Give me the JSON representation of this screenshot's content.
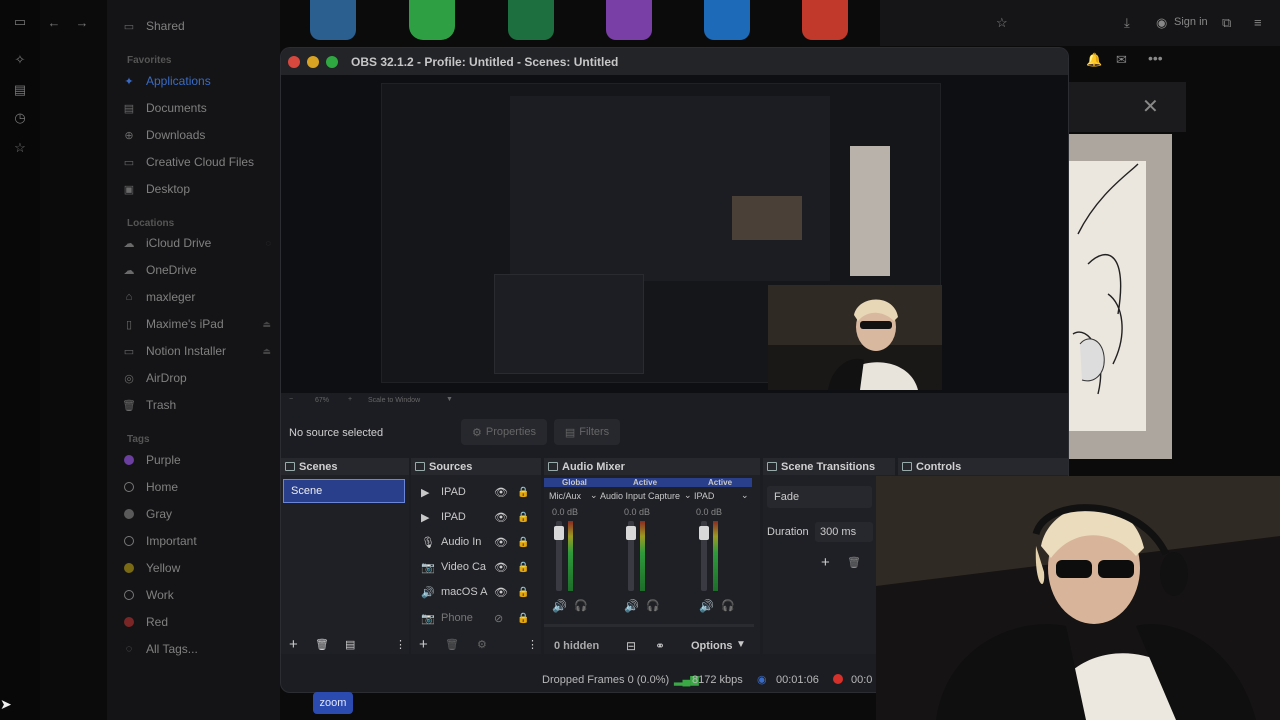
{
  "finder": {
    "shared_label": "Shared",
    "favorites_header": "Favorites",
    "favorites": [
      "Applications",
      "Documents",
      "Downloads",
      "Creative Cloud Files",
      "Desktop"
    ],
    "locations_header": "Locations",
    "locations": [
      "iCloud Drive",
      "OneDrive",
      "maxleger",
      "Maxime's iPad",
      "Notion Installer",
      "AirDrop",
      "Trash"
    ],
    "tags_header": "Tags",
    "tags": [
      {
        "label": "Purple",
        "color": "#7a4ab0"
      },
      {
        "label": "Home",
        "color": ""
      },
      {
        "label": "Gray",
        "color": "#6a6a6a"
      },
      {
        "label": "Important",
        "color": ""
      },
      {
        "label": "Yellow",
        "color": "#8a7a14"
      },
      {
        "label": "Work",
        "color": ""
      },
      {
        "label": "Red",
        "color": "#8a2a2a"
      },
      {
        "label": "All Tags...",
        "color": ""
      }
    ]
  },
  "browser": {
    "signin_label": "Sign in"
  },
  "obs": {
    "title": "OBS 32.1.2 - Profile: Untitled - Scenes: Untitled",
    "zoom_percent": "67%",
    "scale_mode": "Scale to Window",
    "no_source": "No source selected",
    "properties_label": "Properties",
    "filters_label": "Filters",
    "scenes": {
      "header": "Scenes",
      "items": [
        "Scene"
      ]
    },
    "sources": {
      "header": "Sources",
      "items": [
        {
          "icon": "play-icon",
          "label": "IPAD"
        },
        {
          "icon": "play-icon",
          "label": "IPAD"
        },
        {
          "icon": "microphone-icon",
          "label": "Audio In"
        },
        {
          "icon": "camera-icon",
          "label": "Video Ca"
        },
        {
          "icon": "speaker-icon",
          "label": "macOS A"
        },
        {
          "icon": "camera-icon",
          "label": "Phone"
        }
      ]
    },
    "mixer": {
      "header": "Audio Mixer",
      "channels": [
        {
          "scope": "Global",
          "name": "Mic/Aux",
          "db": "0.0 dB"
        },
        {
          "scope": "Active",
          "name": "Audio Input Capture",
          "db": "0.0 dB"
        },
        {
          "scope": "Active",
          "name": "IPAD",
          "db": "0.0 dB"
        }
      ],
      "hidden_label": "0 hidden",
      "options_label": "Options"
    },
    "transitions": {
      "header": "Scene Transitions",
      "type": "Fade",
      "duration_label": "Duration",
      "duration_value": "300 ms"
    },
    "controls": {
      "header": "Controls"
    },
    "status": {
      "dropped": "Dropped Frames 0 (0.0%)",
      "bitrate": "8172 kbps",
      "time1": "00:01:06",
      "time2": "00:0"
    }
  },
  "dock": {
    "zoom_label": "zoom"
  }
}
